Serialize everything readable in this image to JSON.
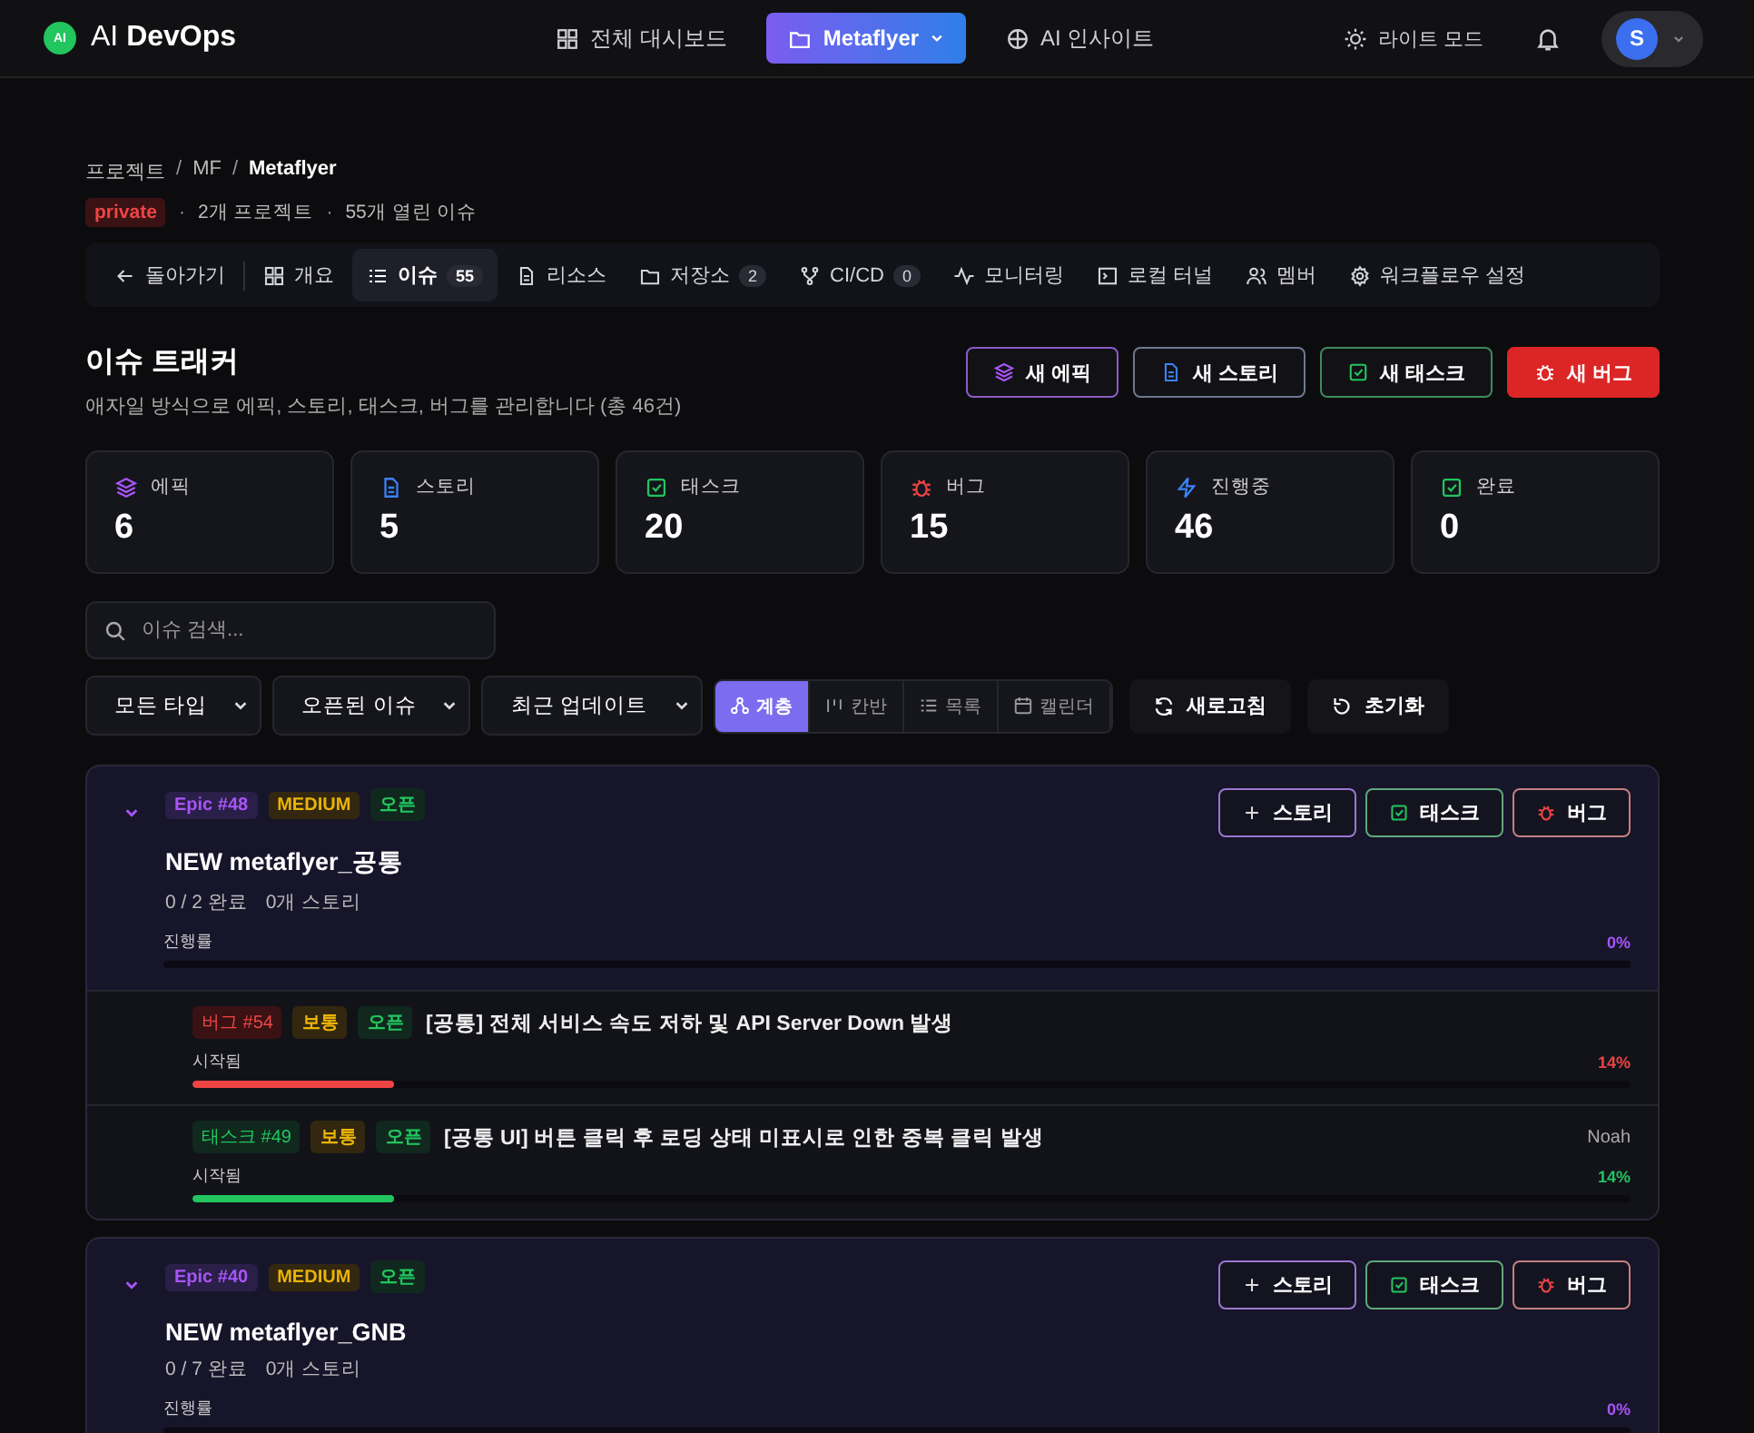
{
  "header": {
    "logo_badge": "AI",
    "brand": "AI **DevOps**",
    "nav": [
      {
        "label": "전체 대시보드",
        "selected": false,
        "dropdown": false
      },
      {
        "label": "Metaflyer",
        "selected": true,
        "dropdown": true
      },
      {
        "label": "AI 인사이트",
        "selected": false,
        "dropdown": false
      }
    ],
    "theme_toggle": "라이트 모드",
    "avatar": "S"
  },
  "breadcrumb": {
    "separator": "/",
    "items": [
      "프로젝트",
      "MF",
      "Metaflyer"
    ]
  },
  "project_meta": {
    "visibility": "private",
    "separator": "·",
    "items": [
      "2개 프로젝트",
      "55개 열린 이슈"
    ]
  },
  "tabs": [
    {
      "label": "돌아가기",
      "selected": false
    },
    {
      "label": "개요",
      "selected": false
    },
    {
      "label": "이슈",
      "count": "55",
      "selected": true
    },
    {
      "label": "리소스",
      "selected": false
    },
    {
      "label": "저장소",
      "count": "2",
      "selected": false
    },
    {
      "label": "CI/CD",
      "count": "0",
      "selected": false
    },
    {
      "label": "모니터링",
      "selected": false
    },
    {
      "label": "로컬 터널",
      "selected": false
    },
    {
      "label": "멤버",
      "selected": false
    },
    {
      "label": "워크플로우 설정",
      "selected": false
    }
  ],
  "tracker": {
    "title": "이슈 트래커",
    "subtitle": "애자일 방식으로 에픽, 스토리, 태스크, 버그를 관리합니다 (총 46건)",
    "buttons": [
      {
        "kind": "epic",
        "label": "새 에픽"
      },
      {
        "kind": "story",
        "label": "새 스토리"
      },
      {
        "kind": "task",
        "label": "새 태스크"
      },
      {
        "kind": "bug",
        "label": "새 버그"
      }
    ]
  },
  "stats": [
    {
      "kind": "epic",
      "label": "에픽",
      "value": "6"
    },
    {
      "kind": "story",
      "label": "스토리",
      "value": "5"
    },
    {
      "kind": "task",
      "label": "태스크",
      "value": "20"
    },
    {
      "kind": "bug",
      "label": "버그",
      "value": "15"
    },
    {
      "kind": "progress",
      "label": "진행중",
      "value": "46"
    },
    {
      "kind": "done",
      "label": "완료",
      "value": "0"
    }
  ],
  "search": {
    "placeholder": "이슈 검색..."
  },
  "filters": [
    {
      "label": "모든 타입"
    },
    {
      "label": "오픈된 이슈"
    },
    {
      "label": "최근 업데이트"
    }
  ],
  "views": [
    {
      "label": "계층",
      "selected": true
    },
    {
      "label": "칸반",
      "selected": false
    },
    {
      "label": "목록",
      "selected": false
    },
    {
      "label": "캘린더",
      "selected": false
    }
  ],
  "actions": [
    {
      "label": "새로고침"
    },
    {
      "label": "초기화"
    }
  ],
  "epics": [
    {
      "expanded": true,
      "tag": "Epic #48",
      "priority": "MEDIUM",
      "status": "오픈",
      "title": "NEW metaflyer_공통",
      "summary": [
        "0 / 2 완료",
        "0개 스토리"
      ],
      "progress_label": "진행률",
      "level": 0,
      "percent": "0%",
      "actions": [
        {
          "kind": "story",
          "label": "스토리"
        },
        {
          "kind": "task",
          "label": "태스크"
        },
        {
          "kind": "bug",
          "label": "버그"
        }
      ],
      "children": [
        {
          "kind": "bug",
          "tag": "버그 #54",
          "priority": "보통",
          "status": "오픈",
          "title": "[공통] 전체 서비스 속도 저하 및 API Server Down 발생",
          "progress_label": "시작됨",
          "level": 0.14,
          "percent": "14%"
        },
        {
          "kind": "task",
          "tag": "태스크 #49",
          "priority": "보통",
          "status": "오픈",
          "title": "[공통 UI] 버튼 클릭 후 로딩 상태 미표시로 인한 중복 클릭 발생",
          "assignee": "Noah",
          "progress_label": "시작됨",
          "level": 0.14,
          "percent": "14%"
        }
      ]
    },
    {
      "expanded": true,
      "tag": "Epic #40",
      "priority": "MEDIUM",
      "status": "오픈",
      "title": "NEW metaflyer_GNB",
      "summary": [
        "0 / 7 완료",
        "0개 스토리"
      ],
      "progress_label": "진행률",
      "level": 0,
      "percent": "0%",
      "actions": [
        {
          "kind": "story",
          "label": "스토리"
        },
        {
          "kind": "task",
          "label": "태스크"
        },
        {
          "kind": "bug",
          "label": "버그"
        }
      ]
    }
  ]
}
